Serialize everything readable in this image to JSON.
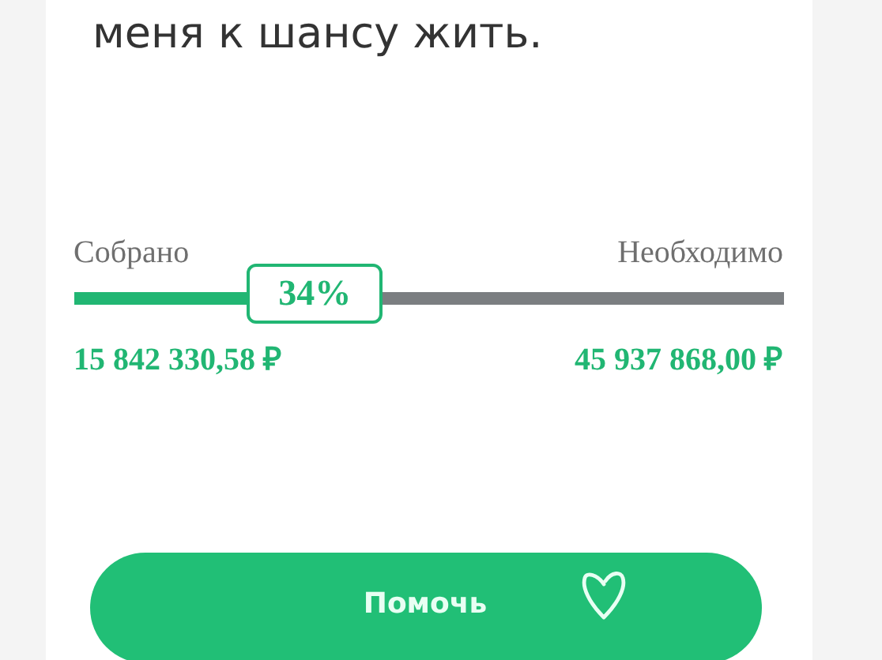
{
  "text": "меня к шансу жить.",
  "progress": {
    "collected_label": "Собрано",
    "needed_label": "Необходимо",
    "level": 0.34,
    "percent": "34%",
    "collected_amount": "15 842 330,58 ₽",
    "needed_amount": "45 937 868,00 ₽"
  },
  "button": {
    "label": "Помочь"
  }
}
